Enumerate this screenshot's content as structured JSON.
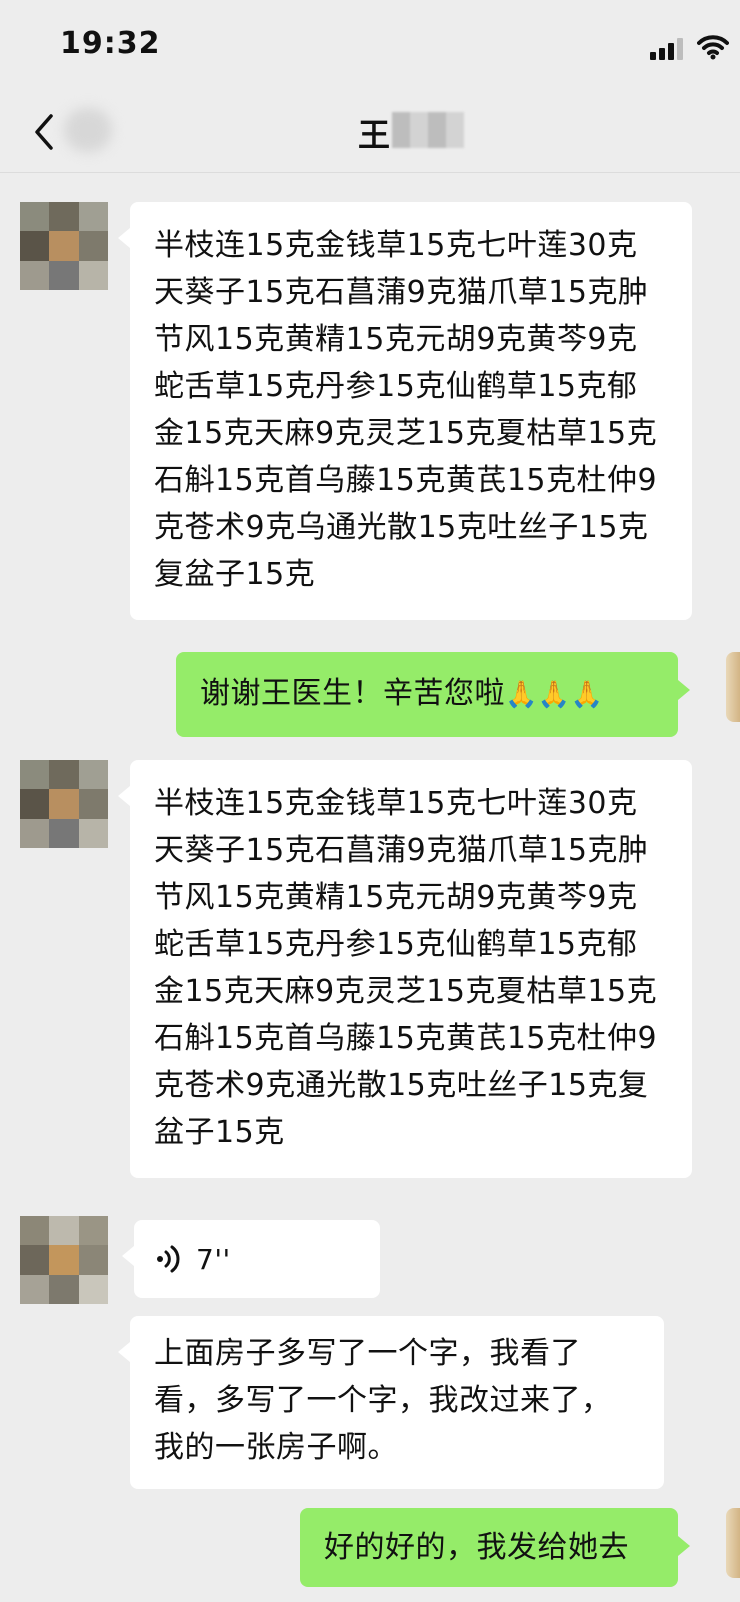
{
  "status_bar": {
    "time": "19:32",
    "icons": [
      "signal-icon",
      "wifi-icon"
    ]
  },
  "header": {
    "back_icon": "chevron-left-icon",
    "title": "王"
  },
  "messages": [
    {
      "sender": "contact",
      "type": "text",
      "text": "半枝连15克金钱草15克七叶莲30克天葵子15克石菖蒲9克猫爪草15克肿节风15克黄精15克元胡9克黄芩9克蛇舌草15克丹参15克仙鹤草15克郁金15克天麻9克灵芝15克夏枯草15克石斛15克首乌藤15克黄芪15克杜仲9克苍术9克乌通光散15克吐丝子15克复盆子15克"
    },
    {
      "sender": "me",
      "type": "text",
      "text": "谢谢王医生！辛苦您啦",
      "emoji": "🙏🙏🙏"
    },
    {
      "sender": "contact",
      "type": "text",
      "text": "半枝连15克金钱草15克七叶莲30克天葵子15克石菖蒲9克猫爪草15克肿节风15克黄精15克元胡9克黄芩9克蛇舌草15克丹参15克仙鹤草15克郁金15克天麻9克灵芝15克夏枯草15克石斛15克首乌藤15克黄芪15克杜仲9克苍术9克通光散15克吐丝子15克复盆子15克"
    },
    {
      "sender": "contact",
      "type": "voice",
      "duration": "7''"
    },
    {
      "sender": "contact",
      "type": "text",
      "text": "上面房子多写了一个字，我看了看，多写了一个字，我改过来了，我的一张房子啊。"
    },
    {
      "sender": "me",
      "type": "text",
      "text": "好的好的，我发给她去"
    }
  ],
  "colors": {
    "background": "#ededed",
    "incoming_bubble": "#ffffff",
    "outgoing_bubble": "#95ec69"
  }
}
